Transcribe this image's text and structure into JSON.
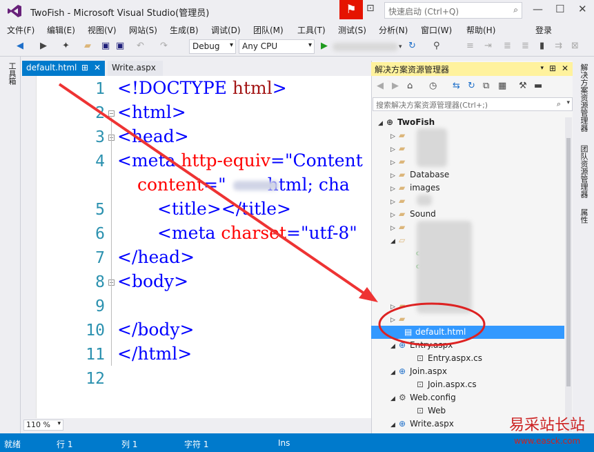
{
  "window": {
    "title": "TwoFish - Microsoft Visual Studio(管理员)",
    "quick_launch_placeholder": "快速启动 (Ctrl+Q)"
  },
  "menu": [
    "文件(F)",
    "编辑(E)",
    "视图(V)",
    "网站(S)",
    "生成(B)",
    "调试(D)",
    "团队(M)",
    "工具(T)",
    "测试(S)",
    "分析(N)",
    "窗口(W)",
    "帮助(H)"
  ],
  "login": "登录",
  "toolbar": {
    "config": "Debug",
    "platform": "Any CPU"
  },
  "left_tab": "工具箱",
  "tabs": [
    {
      "label": "default.html",
      "pin": "⊞",
      "close": "✕"
    },
    {
      "label": "Write.aspx"
    }
  ],
  "code": {
    "lines": [
      "1",
      "2",
      "3",
      "4",
      "",
      "5",
      "6",
      "7",
      "8",
      "9",
      "10",
      "11",
      "12"
    ],
    "l1a": "<!DOCTYPE ",
    "l1b": "html",
    ">": ">",
    "l2": "<html>",
    "l3": "<head>",
    "l4a": "<meta ",
    "l4b": "http-equiv",
    "l4c": "=\"Content",
    "l4d": "content",
    "l4e": "=\"",
    "l4f": "html; cha",
    "l5a": "<title>",
    "l5b": "</title>",
    "l6a": "<meta ",
    "l6b": "charset",
    "l6c": "=\"utf-8\"",
    "l7": "</head>",
    "l8": "<body>",
    "l10": "</body>",
    "l11": "</html>"
  },
  "zoom": "110 %",
  "solution_explorer": {
    "title": "解决方案资源管理器",
    "search_placeholder": "搜索解决方案资源管理器(Ctrl+;)",
    "solution": "TwoFish",
    "items": [
      "Database",
      "images",
      "Sound",
      "default.html",
      "Entry.aspx",
      "Entry.aspx.cs",
      "Join.aspx",
      "Join.aspx.cs",
      "Web.config",
      "Web",
      "Write.aspx"
    ]
  },
  "right_tabs": [
    "解决方案资源管理器",
    "团队资源管理器",
    "属性"
  ],
  "status": {
    "ready": "就绪",
    "row": "行 1",
    "col": "列 1",
    "char": "字符 1",
    "ins": "Ins"
  },
  "watermark": {
    "logo": "易采站长站",
    "url": "www.easck.com"
  }
}
